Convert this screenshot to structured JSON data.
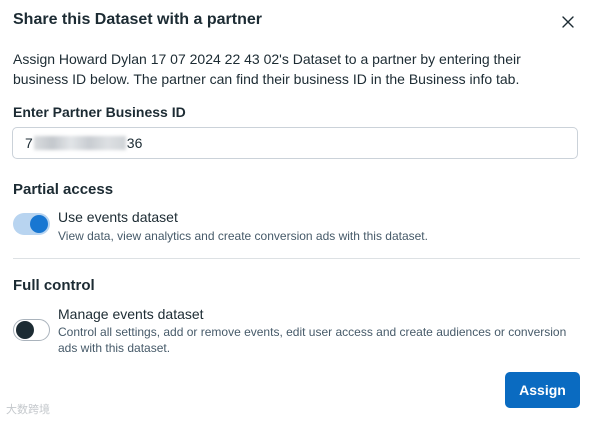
{
  "dialog": {
    "title": "Share this Dataset with a partner",
    "description": "Assign Howard Dylan 17 07 2024 22 43 02's Dataset to a partner by entering their business ID below. The partner can find their business ID in the Business info tab.",
    "close_icon": "close-icon"
  },
  "partner_id": {
    "label": "Enter Partner Business ID",
    "value_start": "7",
    "value_end": "36"
  },
  "partial_access": {
    "heading": "Partial access",
    "option_title": "Use events dataset",
    "option_desc": "View data, view analytics and create conversion ads with this dataset.",
    "enabled": true
  },
  "full_control": {
    "heading": "Full control",
    "option_title": "Manage events dataset",
    "option_desc": "Control all settings, add or remove events, edit user access and create audiences or conversion ads with this dataset.",
    "enabled": false
  },
  "actions": {
    "assign_label": "Assign"
  },
  "colors": {
    "primary": "#0a6bc1",
    "toggle_on": "#1877d2",
    "text": "#1c2b33"
  },
  "watermark": {
    "text": "大数跨境"
  }
}
